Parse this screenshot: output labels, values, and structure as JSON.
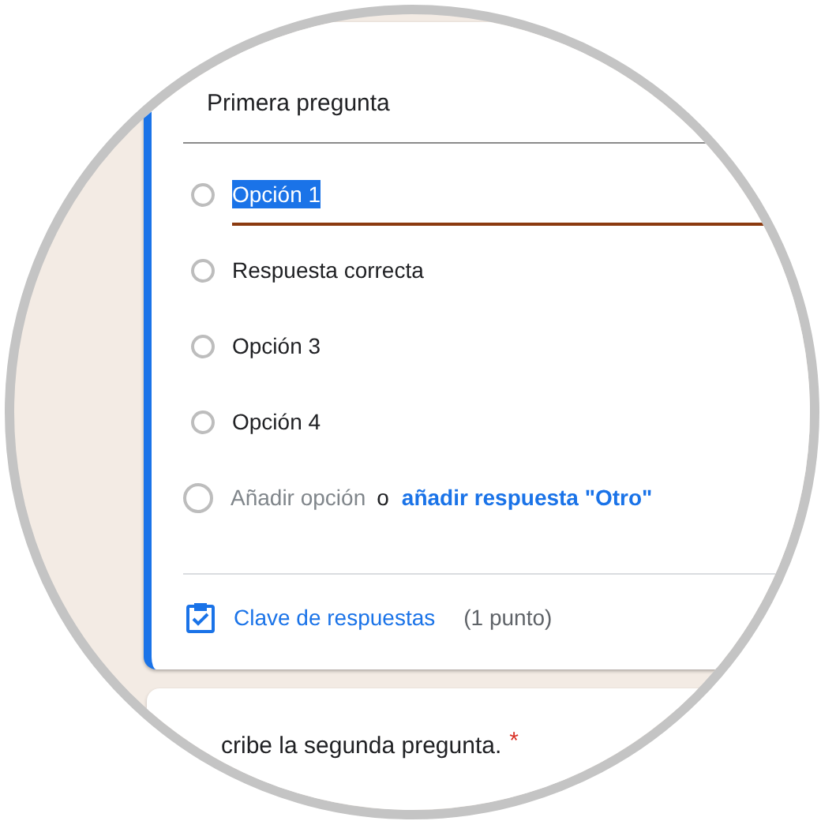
{
  "question": {
    "title": "Primera pregunta",
    "options": [
      {
        "label": "Opción 1",
        "editing": true,
        "selected": false
      },
      {
        "label": "Respuesta correcta",
        "editing": false,
        "selected": false
      },
      {
        "label": "Opción 3",
        "editing": false,
        "selected": false
      },
      {
        "label": "Opción 4",
        "editing": false,
        "selected": false
      }
    ],
    "add_option": {
      "label": "Añadir opción",
      "selected": false,
      "separator": "o",
      "other_link": "añadir respuesta \"Otro\""
    }
  },
  "footer": {
    "answer_key": "Clave de respuestas",
    "points": "(1 punto)"
  },
  "next_question": {
    "title": "cribe la segunda pregunta.",
    "required_mark": "*"
  }
}
